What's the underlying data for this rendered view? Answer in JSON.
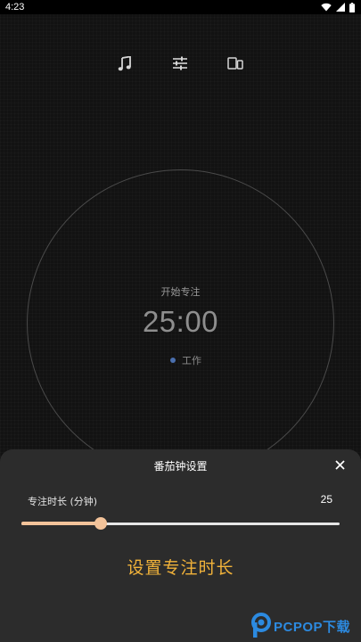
{
  "status_bar": {
    "time": "4:23",
    "icons": [
      "wifi-icon",
      "signal-icon",
      "battery-icon"
    ]
  },
  "toolbar": {
    "items": [
      "music-note-icon",
      "tune-sliders-icon",
      "device-icon"
    ]
  },
  "timer": {
    "label": "开始专注",
    "time": "25:00",
    "tag": "工作",
    "tag_color": "#4a6fae"
  },
  "sheet": {
    "title": "番茄钟设置",
    "close_icon": "close-icon",
    "setting_label": "专注时长 (分钟)",
    "setting_value": "25",
    "slider": {
      "min": 0,
      "max": 100,
      "value": 25,
      "fraction": 0.25
    },
    "apply_label": "设置专注时长",
    "accent_color": "#f2b33a",
    "slider_color": "#f3c39a"
  },
  "watermark": {
    "brand": "PCPOP下载"
  }
}
